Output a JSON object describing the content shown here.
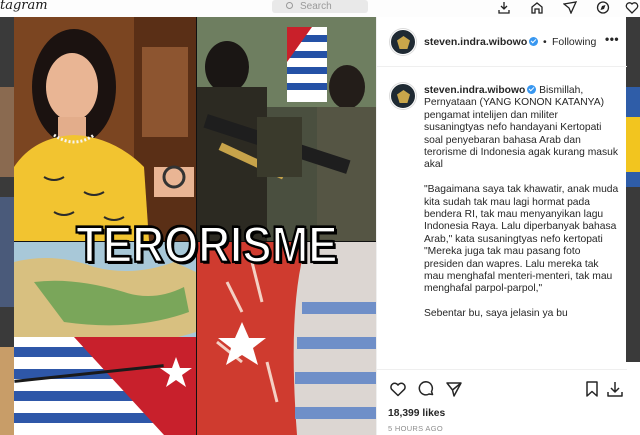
{
  "background": {
    "logo": "tagram",
    "search_placeholder": "Search"
  },
  "post": {
    "username": "steven.indra.wibowo",
    "dot": "•",
    "follow_label": "Following",
    "more_label": "•••",
    "image_overlay_text": "TERORISME",
    "caption_paragraphs": [
      "Bismillah, Pernyataan (YANG KONON KATANYA) pengamat intelijen dan militer susaningtyas nefo handayani Kertopati soal penyebaran bahasa Arab dan terorisme di Indonesia agak kurang masuk akal",
      "\"Bagaimana saya tak khawatir, anak muda kita sudah tak mau lagi hormat pada bendera RI, tak mau menyanyikan lagu Indonesia Raya. Lalu diperbanyak bahasa Arab,\" kata susaningtyas nefo kertopati \"Mereka juga tak mau pasang foto presiden dan wapres. Lalu mereka tak mau menghafal menteri-menteri, tak mau menghafal parpol-parpol,\"",
      "Sebentar bu, saya jelasin ya bu"
    ],
    "likes": "18,399 likes",
    "timestamp": "5 HOURS AGO"
  },
  "icons": [
    "search-icon",
    "inbox-icon",
    "home-icon",
    "explore-icon",
    "heart-icon",
    "comment-icon",
    "share-icon",
    "bookmark-icon",
    "download-icon",
    "verified-icon"
  ],
  "colors": {
    "verified": "#3897f0",
    "text": "#262626",
    "muted": "#8e8e8e",
    "backdrop": "#2b2b2b"
  }
}
